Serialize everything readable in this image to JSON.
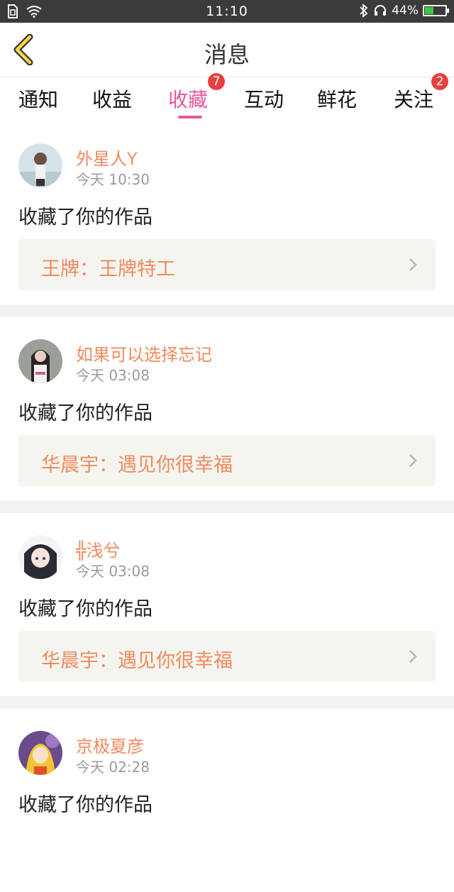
{
  "status_bar": {
    "time": "11:10",
    "battery_text": "44%",
    "battery_level": 0.44
  },
  "header": {
    "title": "消息"
  },
  "tabs": [
    {
      "label": "通知",
      "active": false,
      "badge": ""
    },
    {
      "label": "收益",
      "active": false,
      "badge": ""
    },
    {
      "label": "收藏",
      "active": true,
      "badge": "7"
    },
    {
      "label": "互动",
      "active": false,
      "badge": ""
    },
    {
      "label": "鲜花",
      "active": false,
      "badge": ""
    },
    {
      "label": "关注",
      "active": false,
      "badge": "2"
    }
  ],
  "messages": [
    {
      "user": "外星人Y",
      "time": "今天 10:30",
      "action": "收藏了你的作品",
      "work": "王牌：王牌特工"
    },
    {
      "user": "如果可以选择忘记",
      "time": "今天 03:08",
      "action": "收藏了你的作品",
      "work": "华晨宇：遇见你很幸福"
    },
    {
      "user": "╬浅兮",
      "time": "今天 03:08",
      "action": "收藏了你的作品",
      "work": "华晨宇：遇见你很幸福"
    },
    {
      "user": "京极夏彦",
      "time": "今天 02:28",
      "action": "收藏了你的作品",
      "work": ""
    }
  ],
  "colors": {
    "accent": "#e8579a",
    "username": "#f08a5d",
    "badge": "#e94040"
  }
}
